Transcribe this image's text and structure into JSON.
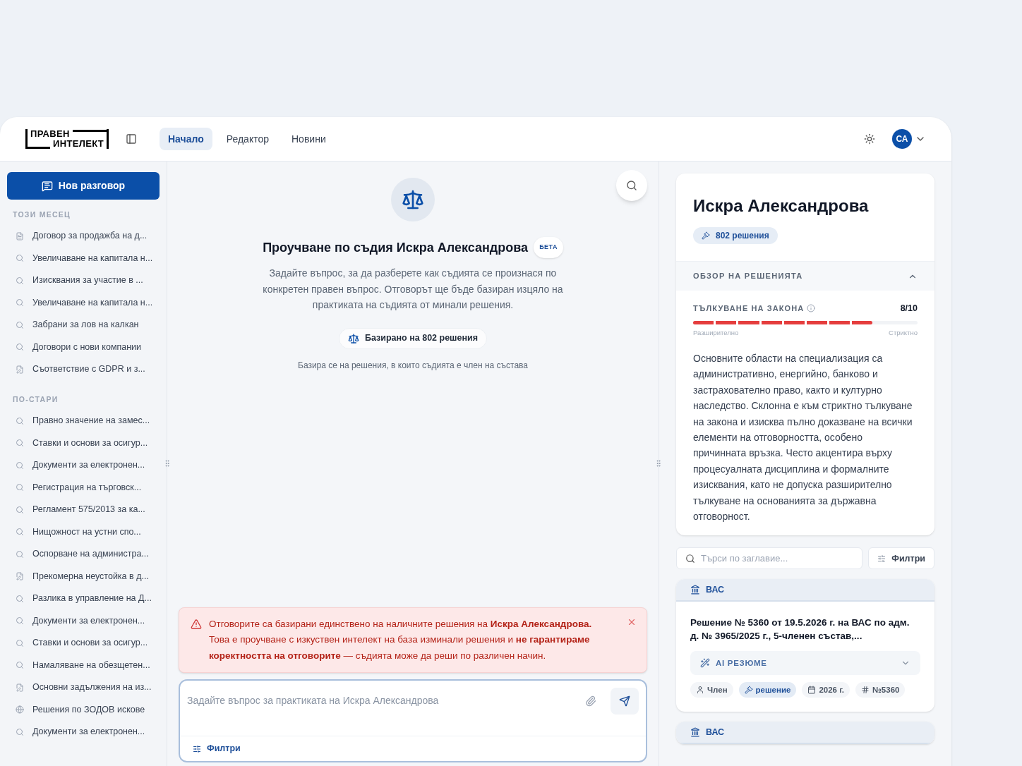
{
  "logo": {
    "line_1": "ПРАВЕН",
    "line_2": "ИНТЕЛЕКТ"
  },
  "nav": [
    {
      "label": "Начало",
      "selected": true
    },
    {
      "label": "Редактор",
      "selected": false
    },
    {
      "label": "Новини",
      "selected": false
    }
  ],
  "user": {
    "initials": "СА"
  },
  "sidebar": {
    "new_button": "Нов разговор",
    "groups": [
      {
        "title": "ТОЗИ МЕСЕЦ",
        "items": [
          {
            "kind": "document",
            "label": "Договор за продажба на д..."
          },
          {
            "kind": "search",
            "label": "Увеличаване на капитала н..."
          },
          {
            "kind": "search",
            "label": "Изисквания за участие в ..."
          },
          {
            "kind": "search",
            "label": "Увеличаване на капитала н..."
          },
          {
            "kind": "search",
            "label": "Забрани за лов на калкан"
          },
          {
            "kind": "search",
            "label": "Договори с нови компании"
          },
          {
            "kind": "note",
            "label": "Съответствие с GDPR и з..."
          }
        ]
      },
      {
        "title": "ПО-СТАРИ",
        "items": [
          {
            "kind": "search",
            "label": "Правно значение на замес..."
          },
          {
            "kind": "search",
            "label": "Ставки и основи за осигур..."
          },
          {
            "kind": "search",
            "label": "Документи за електронен..."
          },
          {
            "kind": "search",
            "label": "Регистрация на търговск..."
          },
          {
            "kind": "search",
            "label": "Регламент 575/2013 за ка..."
          },
          {
            "kind": "search",
            "label": "Нищожност на устни спо..."
          },
          {
            "kind": "search",
            "label": "Оспорване на администра..."
          },
          {
            "kind": "note",
            "label": "Прекомерна неустойка в д..."
          },
          {
            "kind": "search",
            "label": "Разлика в управление на Д..."
          },
          {
            "kind": "search",
            "label": "Документи за електронен..."
          },
          {
            "kind": "search",
            "label": "Ставки и основи за осигур..."
          },
          {
            "kind": "search",
            "label": "Намаляване на обезщетен..."
          },
          {
            "kind": "note",
            "label": "Основни задължения на из..."
          },
          {
            "kind": "globe",
            "label": "Решения по ЗОДОВ искове"
          },
          {
            "kind": "search",
            "label": "Документи за електронен..."
          }
        ]
      }
    ]
  },
  "hero": {
    "title": "Проучване по съдия Искра Александрова",
    "badge": "БЕТА",
    "description": "Задайте въпрос, за да разберете как съдията се произнася по конкретен правен въпрос. Отговорът ще бъде базиран изцяло на практиката на съдията от минали решения.",
    "chip": "Базирано на 802 решения",
    "note": "Базира се на решения, в които съдията е член на състава"
  },
  "warning": {
    "text": "Отговорите са базирани единствено на наличните решения на **Искра Александрова.** Това е проучване с изкуствен интелект на база изминали решения и **не гарантираме коректността на отговорите** — съдията може да реши по различен начин."
  },
  "composer": {
    "placeholder": "Задайте въпрос за практиката на Искра Александрова",
    "filters": "Филтри"
  },
  "judge": {
    "name": "Искра Александрова",
    "decisions": "802 решения",
    "overview_title": "ОБЗОР НА РЕШЕНИЯТА",
    "expanded": true,
    "meter": {
      "label": "ТЪЛКУВАНЕ НА ЗАКОНА",
      "reading": "8/10",
      "level": 0.8,
      "min_label": "Разширително",
      "max_label": "Стриктно"
    },
    "summary": "Основните области на специализация са административно, енергийно, банково и застрахователно право, както и културно наследство. Склонна е към стриктно тълкуване на закона и изисква пълно доказване на всички елементи на отговорността, особено причинната връзка. Често акцентира върху процесуалната дисциплина и формалните изисквания, като не допуска разширително тълкуване на основанията за държавна отговорност."
  },
  "decision_search": {
    "placeholder": "Търси по заглавие...",
    "filters": "Филтри"
  },
  "decisions": [
    {
      "court": "ВАС",
      "title": "Решение № 5360 от 19.5.2026 г. на ВАС по адм. д. № 3965/2025 г., 5-членен състав,...",
      "ai_summary": "AI РЕЗЮМЕ",
      "tags": [
        {
          "kind": "person",
          "label": "Член",
          "highlighted": false
        },
        {
          "kind": "gavel",
          "label": "решение",
          "highlighted": true
        },
        {
          "kind": "calendar",
          "label": "2026 г.",
          "highlighted": false
        },
        {
          "kind": "hash",
          "label": "№5360",
          "highlighted": false
        }
      ]
    },
    {
      "court": "ВАС"
    }
  ]
}
